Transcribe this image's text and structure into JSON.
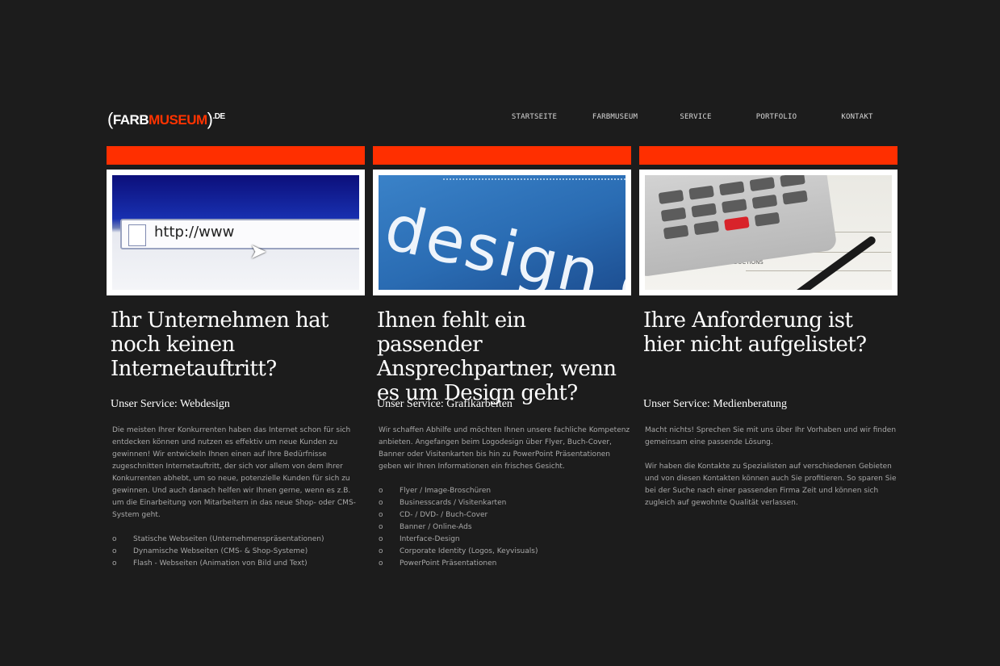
{
  "brand": {
    "paren_open": "(",
    "word1": "FARB",
    "word2": "MUSEUM",
    "paren_close": ")",
    "tld": ".DE",
    "accent_color": "#ff3300"
  },
  "nav": [
    "STARTSEITE",
    "FARBMUSEUM",
    "SERVICE",
    "PORTFOLIO",
    "KONTAKT"
  ],
  "colors": {
    "background": "#1c1c1c",
    "bar": "#ff2f00",
    "heading": "#ffffff",
    "text": "#a8a8a8"
  },
  "columns": [
    {
      "image_text": "http://www",
      "headline": "Ihr Unternehmen hat noch keinen Internetauftritt?",
      "service": "Unser Service: Webdesign",
      "paragraphs": [
        "Die meisten Ihrer Konkurrenten haben das Internet schon für sich entdecken können und nutzen es effektiv um neue Kunden zu gewinnen! Wir entwickeln Ihnen einen auf Ihre Bedürfnisse zugeschnitten Internetauftritt, der sich vor allem von dem Ihrer Konkurrenten abhebt, um so neue, potenzielle Kunden für sich zu gewinnen. Und auch danach helfen wir Ihnen gerne, wenn es z.B. um die Einarbeitung von Mitarbeitern in das neue Shop- oder CMS-System geht."
      ],
      "bullets": [
        "Statische Webseiten (Unternehmenspräsentationen)",
        "Dynamische Webseiten (CMS- & Shop-Systeme)",
        "Flash - Webseiten (Animation von Bild und Text)"
      ]
    },
    {
      "image_text": "design e",
      "headline": "Ihnen fehlt ein passender Ansprechpartner, wenn es um Design geht?",
      "service": "Unser Service: Grafikarbeiten",
      "paragraphs": [
        "Wir schaffen Abhilfe und möchten Ihnen unsere fachliche Kompetenz anbieten. Angefangen beim Logodesign über Flyer, Buch-Cover, Banner oder Visitenkarten bis hin zu PowerPoint Präsentationen geben wir Ihren Informationen ein frisches Gesicht."
      ],
      "bullets": [
        "Flyer / Image-Broschüren",
        "Businesscards / Visitenkarten",
        "CD- / DVD- / Buch-Cover",
        "Banner / Online-Ads",
        "Interface-Design",
        "Corporate Identity (Logos, Keyvisuals)",
        "PowerPoint Präsentationen"
      ]
    },
    {
      "image_text": "DEDUCTIONS",
      "headline": "Ihre Anforderung ist hier nicht aufgelistet?",
      "service": "Unser Service: Medienberatung",
      "paragraphs": [
        "Macht nichts! Sprechen Sie mit uns über Ihr Vorhaben und wir finden gemeinsam eine passende Lösung.",
        "Wir haben die Kontakte zu Spezialisten auf verschiedenen Gebieten und von diesen Kontakten können auch Sie profitieren. So sparen Sie bei der Suche nach einer passenden Firma Zeit und können sich zugleich auf gewohnte Qualität verlassen."
      ],
      "bullets": []
    }
  ],
  "bullet_glyph": "o"
}
